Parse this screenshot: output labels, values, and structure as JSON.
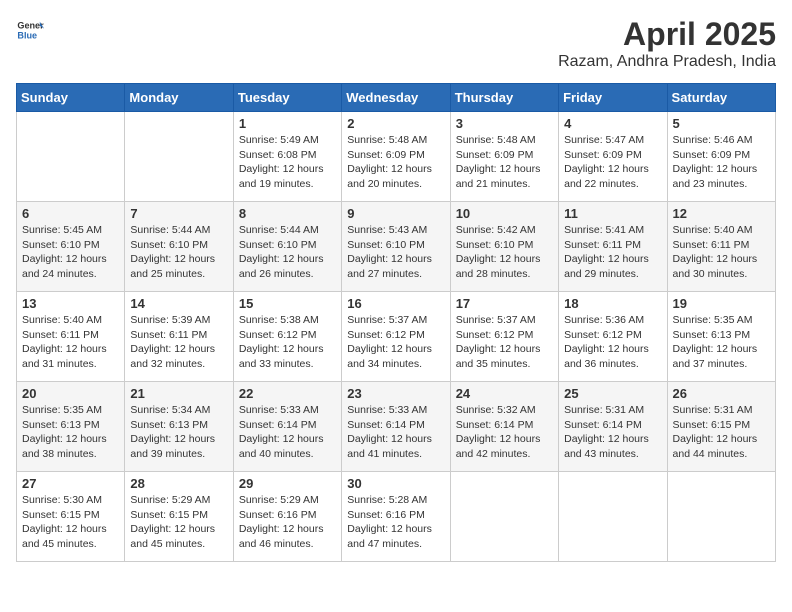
{
  "header": {
    "logo_general": "General",
    "logo_blue": "Blue",
    "title": "April 2025",
    "subtitle": "Razam, Andhra Pradesh, India"
  },
  "calendar": {
    "days_of_week": [
      "Sunday",
      "Monday",
      "Tuesday",
      "Wednesday",
      "Thursday",
      "Friday",
      "Saturday"
    ],
    "weeks": [
      [
        {
          "day": "",
          "info": ""
        },
        {
          "day": "",
          "info": ""
        },
        {
          "day": "1",
          "sunrise": "Sunrise: 5:49 AM",
          "sunset": "Sunset: 6:08 PM",
          "daylight": "Daylight: 12 hours and 19 minutes."
        },
        {
          "day": "2",
          "sunrise": "Sunrise: 5:48 AM",
          "sunset": "Sunset: 6:09 PM",
          "daylight": "Daylight: 12 hours and 20 minutes."
        },
        {
          "day": "3",
          "sunrise": "Sunrise: 5:48 AM",
          "sunset": "Sunset: 6:09 PM",
          "daylight": "Daylight: 12 hours and 21 minutes."
        },
        {
          "day": "4",
          "sunrise": "Sunrise: 5:47 AM",
          "sunset": "Sunset: 6:09 PM",
          "daylight": "Daylight: 12 hours and 22 minutes."
        },
        {
          "day": "5",
          "sunrise": "Sunrise: 5:46 AM",
          "sunset": "Sunset: 6:09 PM",
          "daylight": "Daylight: 12 hours and 23 minutes."
        }
      ],
      [
        {
          "day": "6",
          "sunrise": "Sunrise: 5:45 AM",
          "sunset": "Sunset: 6:10 PM",
          "daylight": "Daylight: 12 hours and 24 minutes."
        },
        {
          "day": "7",
          "sunrise": "Sunrise: 5:44 AM",
          "sunset": "Sunset: 6:10 PM",
          "daylight": "Daylight: 12 hours and 25 minutes."
        },
        {
          "day": "8",
          "sunrise": "Sunrise: 5:44 AM",
          "sunset": "Sunset: 6:10 PM",
          "daylight": "Daylight: 12 hours and 26 minutes."
        },
        {
          "day": "9",
          "sunrise": "Sunrise: 5:43 AM",
          "sunset": "Sunset: 6:10 PM",
          "daylight": "Daylight: 12 hours and 27 minutes."
        },
        {
          "day": "10",
          "sunrise": "Sunrise: 5:42 AM",
          "sunset": "Sunset: 6:10 PM",
          "daylight": "Daylight: 12 hours and 28 minutes."
        },
        {
          "day": "11",
          "sunrise": "Sunrise: 5:41 AM",
          "sunset": "Sunset: 6:11 PM",
          "daylight": "Daylight: 12 hours and 29 minutes."
        },
        {
          "day": "12",
          "sunrise": "Sunrise: 5:40 AM",
          "sunset": "Sunset: 6:11 PM",
          "daylight": "Daylight: 12 hours and 30 minutes."
        }
      ],
      [
        {
          "day": "13",
          "sunrise": "Sunrise: 5:40 AM",
          "sunset": "Sunset: 6:11 PM",
          "daylight": "Daylight: 12 hours and 31 minutes."
        },
        {
          "day": "14",
          "sunrise": "Sunrise: 5:39 AM",
          "sunset": "Sunset: 6:11 PM",
          "daylight": "Daylight: 12 hours and 32 minutes."
        },
        {
          "day": "15",
          "sunrise": "Sunrise: 5:38 AM",
          "sunset": "Sunset: 6:12 PM",
          "daylight": "Daylight: 12 hours and 33 minutes."
        },
        {
          "day": "16",
          "sunrise": "Sunrise: 5:37 AM",
          "sunset": "Sunset: 6:12 PM",
          "daylight": "Daylight: 12 hours and 34 minutes."
        },
        {
          "day": "17",
          "sunrise": "Sunrise: 5:37 AM",
          "sunset": "Sunset: 6:12 PM",
          "daylight": "Daylight: 12 hours and 35 minutes."
        },
        {
          "day": "18",
          "sunrise": "Sunrise: 5:36 AM",
          "sunset": "Sunset: 6:12 PM",
          "daylight": "Daylight: 12 hours and 36 minutes."
        },
        {
          "day": "19",
          "sunrise": "Sunrise: 5:35 AM",
          "sunset": "Sunset: 6:13 PM",
          "daylight": "Daylight: 12 hours and 37 minutes."
        }
      ],
      [
        {
          "day": "20",
          "sunrise": "Sunrise: 5:35 AM",
          "sunset": "Sunset: 6:13 PM",
          "daylight": "Daylight: 12 hours and 38 minutes."
        },
        {
          "day": "21",
          "sunrise": "Sunrise: 5:34 AM",
          "sunset": "Sunset: 6:13 PM",
          "daylight": "Daylight: 12 hours and 39 minutes."
        },
        {
          "day": "22",
          "sunrise": "Sunrise: 5:33 AM",
          "sunset": "Sunset: 6:14 PM",
          "daylight": "Daylight: 12 hours and 40 minutes."
        },
        {
          "day": "23",
          "sunrise": "Sunrise: 5:33 AM",
          "sunset": "Sunset: 6:14 PM",
          "daylight": "Daylight: 12 hours and 41 minutes."
        },
        {
          "day": "24",
          "sunrise": "Sunrise: 5:32 AM",
          "sunset": "Sunset: 6:14 PM",
          "daylight": "Daylight: 12 hours and 42 minutes."
        },
        {
          "day": "25",
          "sunrise": "Sunrise: 5:31 AM",
          "sunset": "Sunset: 6:14 PM",
          "daylight": "Daylight: 12 hours and 43 minutes."
        },
        {
          "day": "26",
          "sunrise": "Sunrise: 5:31 AM",
          "sunset": "Sunset: 6:15 PM",
          "daylight": "Daylight: 12 hours and 44 minutes."
        }
      ],
      [
        {
          "day": "27",
          "sunrise": "Sunrise: 5:30 AM",
          "sunset": "Sunset: 6:15 PM",
          "daylight": "Daylight: 12 hours and 45 minutes."
        },
        {
          "day": "28",
          "sunrise": "Sunrise: 5:29 AM",
          "sunset": "Sunset: 6:15 PM",
          "daylight": "Daylight: 12 hours and 45 minutes."
        },
        {
          "day": "29",
          "sunrise": "Sunrise: 5:29 AM",
          "sunset": "Sunset: 6:16 PM",
          "daylight": "Daylight: 12 hours and 46 minutes."
        },
        {
          "day": "30",
          "sunrise": "Sunrise: 5:28 AM",
          "sunset": "Sunset: 6:16 PM",
          "daylight": "Daylight: 12 hours and 47 minutes."
        },
        {
          "day": "",
          "info": ""
        },
        {
          "day": "",
          "info": ""
        },
        {
          "day": "",
          "info": ""
        }
      ]
    ]
  }
}
